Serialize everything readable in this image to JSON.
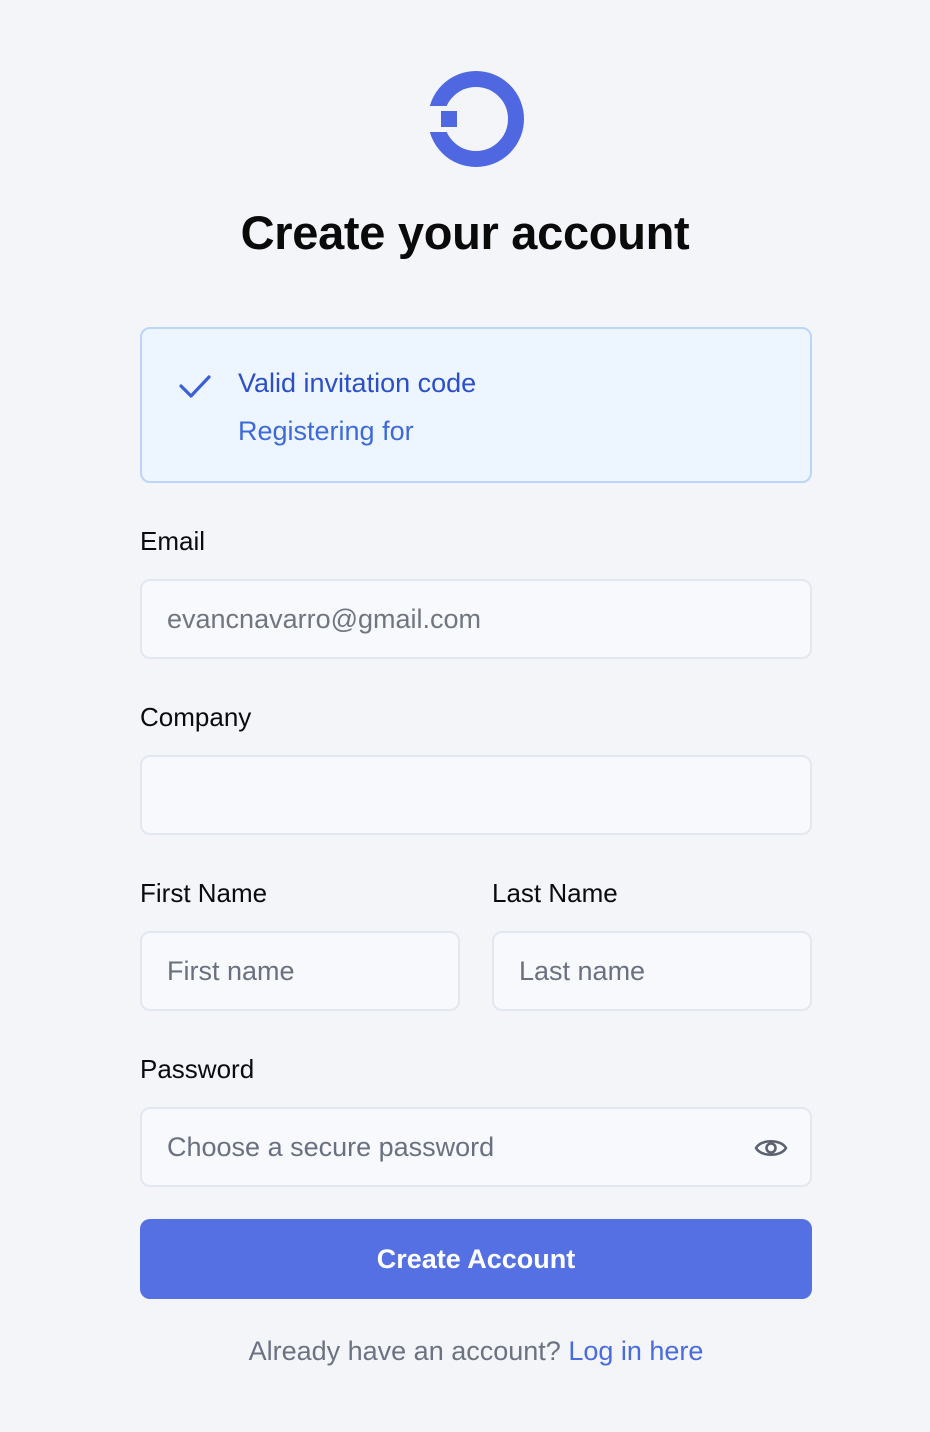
{
  "page": {
    "title": "Create your account"
  },
  "invitation": {
    "title": "Valid invitation code",
    "subtitle": "Registering for",
    "icon": "check-icon",
    "accent": "#2c4fc9"
  },
  "form": {
    "email": {
      "label": "Email",
      "value": "evancnavarro@gmail.com"
    },
    "company": {
      "label": "Company",
      "value": ""
    },
    "first_name": {
      "label": "First Name",
      "placeholder": "First name"
    },
    "last_name": {
      "label": "Last Name",
      "placeholder": "Last name"
    },
    "password": {
      "label": "Password",
      "placeholder": "Choose a secure password",
      "toggle_icon": "eye-icon"
    },
    "submit_label": "Create Account"
  },
  "footer": {
    "prompt": "Already have an account?",
    "link_label": "Log in here"
  },
  "colors": {
    "brand": "#5470e3",
    "background": "#f3f5f9"
  }
}
